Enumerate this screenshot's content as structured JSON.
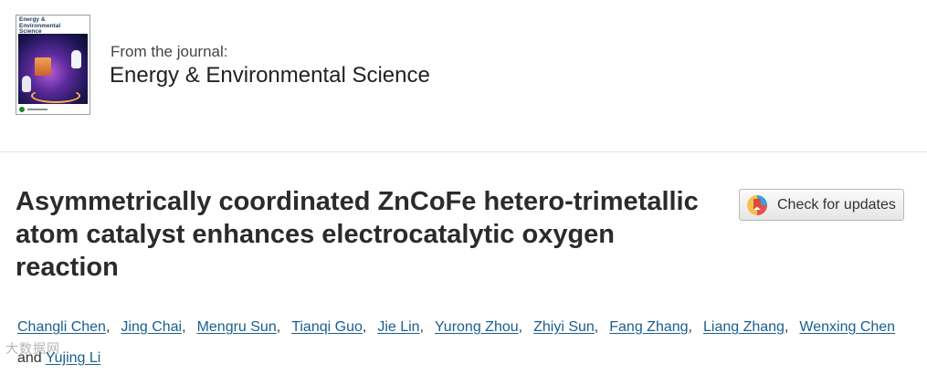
{
  "journal": {
    "cover_title": "Energy & Environmental Science",
    "from_label": "From the journal:",
    "name": "Energy & Environmental Science"
  },
  "article": {
    "title": "Asymmetrically coordinated ZnCoFe hetero-trimetallic atom catalyst enhances electrocatalytic oxygen reaction",
    "check_updates_label": "Check for updates",
    "authors": [
      "Changli Chen",
      "Jing Chai",
      "Mengru Sun",
      "Tianqi Guo",
      "Jie Lin",
      "Yurong Zhou",
      "Zhiyi Sun",
      "Fang Zhang",
      "Liang Zhang",
      "Wenxing Chen",
      "Yujing Li"
    ],
    "author_separator": ",",
    "author_conjunction": "and"
  },
  "watermark": "大数据网",
  "colors": {
    "link": "#1a5f8f",
    "title": "#2b2b2b"
  }
}
